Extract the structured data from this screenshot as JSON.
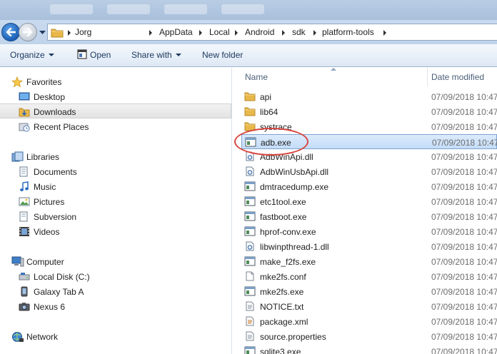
{
  "address": {
    "crumbs": [
      "Jorg",
      "AppData",
      "Local",
      "Android",
      "sdk",
      "platform-tools"
    ]
  },
  "toolbar": {
    "organize": "Organize",
    "open": "Open",
    "share_with": "Share with",
    "new_folder": "New folder"
  },
  "nav": {
    "favorites": {
      "label": "Favorites",
      "items": [
        "Desktop",
        "Downloads",
        "Recent Places"
      ]
    },
    "libraries": {
      "label": "Libraries",
      "items": [
        "Documents",
        "Music",
        "Pictures",
        "Subversion",
        "Videos"
      ]
    },
    "computer": {
      "label": "Computer",
      "items": [
        "Local Disk (C:)",
        "Galaxy Tab A",
        "Nexus 6"
      ]
    },
    "network": {
      "label": "Network"
    },
    "selected_item": "Downloads"
  },
  "columns": {
    "name": "Name",
    "date_modified": "Date modified"
  },
  "files": [
    {
      "name": "api",
      "type": "folder",
      "date": "07/09/2018 10:47"
    },
    {
      "name": "lib64",
      "type": "folder",
      "date": "07/09/2018 10:47"
    },
    {
      "name": "systrace",
      "type": "folder",
      "date": "07/09/2018 10:47"
    },
    {
      "name": "adb.exe",
      "type": "exe",
      "date": "07/09/2018 10:47"
    },
    {
      "name": "AdbWinApi.dll",
      "type": "dll",
      "date": "07/09/2018 10:47"
    },
    {
      "name": "AdbWinUsbApi.dll",
      "type": "dll",
      "date": "07/09/2018 10:47"
    },
    {
      "name": "dmtracedump.exe",
      "type": "exe",
      "date": "07/09/2018 10:47"
    },
    {
      "name": "etc1tool.exe",
      "type": "exe",
      "date": "07/09/2018 10:47"
    },
    {
      "name": "fastboot.exe",
      "type": "exe",
      "date": "07/09/2018 10:47"
    },
    {
      "name": "hprof-conv.exe",
      "type": "exe",
      "date": "07/09/2018 10:47"
    },
    {
      "name": "libwinpthread-1.dll",
      "type": "dll",
      "date": "07/09/2018 10:47"
    },
    {
      "name": "make_f2fs.exe",
      "type": "exe",
      "date": "07/09/2018 10:47"
    },
    {
      "name": "mke2fs.conf",
      "type": "conf",
      "date": "07/09/2018 10:47"
    },
    {
      "name": "mke2fs.exe",
      "type": "exe",
      "date": "07/09/2018 10:47"
    },
    {
      "name": "NOTICE.txt",
      "type": "txt",
      "date": "07/09/2018 10:47"
    },
    {
      "name": "package.xml",
      "type": "xml",
      "date": "07/09/2018 10:47"
    },
    {
      "name": "source.properties",
      "type": "properties",
      "date": "07/09/2018 10:47"
    },
    {
      "name": "sqlite3.exe",
      "type": "exe",
      "date": "07/09/2018 10:47"
    }
  ],
  "selected_file": "adb.exe",
  "colors": {
    "selection_fill": "#cde3fb",
    "selection_border": "#7da2ce",
    "annotation_circle": "#d9443f",
    "folder": "#e8b84a"
  }
}
